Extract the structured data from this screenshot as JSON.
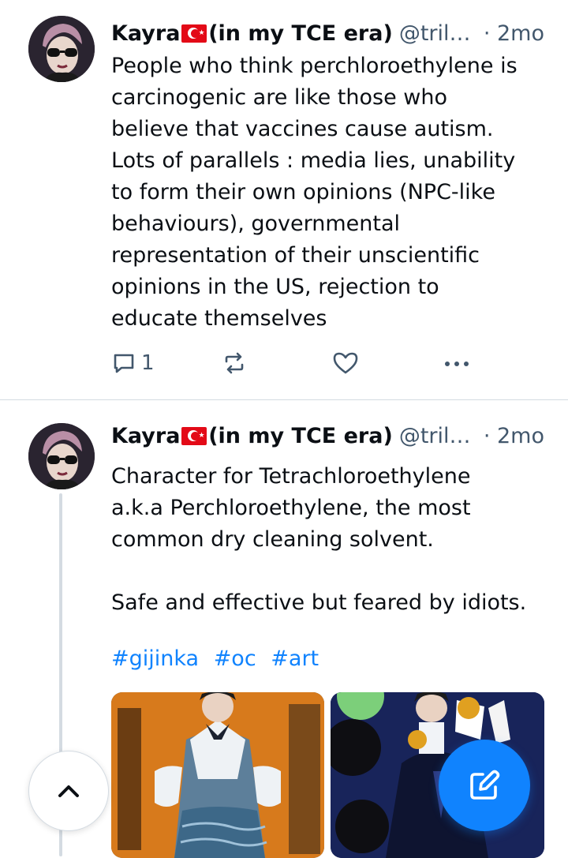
{
  "posts": [
    {
      "author": "Kayra",
      "name_suffix": "(in my TCE era)",
      "handle": "@trile...",
      "time": "· 2mo",
      "text": "People who think perchloroethylene is\ncarcinogenic are like those who\nbelieve that vaccines cause autism.\nLots of parallels : media lies, unability\nto form their own opinions (NPC-like\nbehaviours), governmental\nrepresentation of their unscientific\nopinions in the US, rejection to\neducate themselves",
      "reply_count": "1",
      "icons": {
        "reply": "comment-icon",
        "repost": "repost-icon",
        "like": "heart-icon",
        "more": "more-dots-icon"
      }
    },
    {
      "author": "Kayra",
      "name_suffix": "(in my TCE era)",
      "handle": "@trile...",
      "time": "· 2mo",
      "text": "Character for Tetrachloroethylene\na.k.a Perchloroethylene, the most\ncommon dry cleaning solvent.\n\nSafe and effective but feared by idiots.",
      "hashtags": [
        "#gijinka",
        "#oc",
        "#art"
      ]
    }
  ],
  "floating": {
    "scroll_top_icon": "chevron-up-icon",
    "compose_icon": "compose-icon"
  },
  "colors": {
    "accent": "#1083fe",
    "muted": "#42576c",
    "divider": "#d4dbe2",
    "flag_red": "#e30a17"
  }
}
